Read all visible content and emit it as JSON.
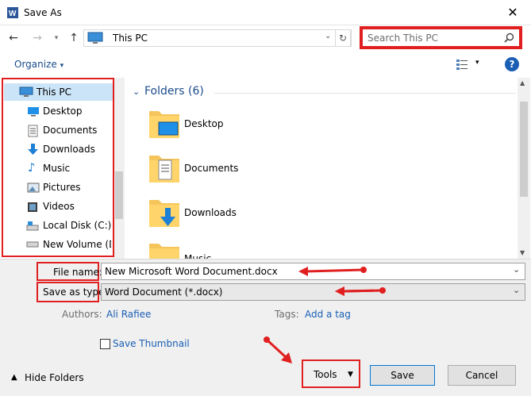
{
  "window": {
    "title": "Save As"
  },
  "address": {
    "location": "This PC"
  },
  "search": {
    "placeholder": "Search This PC"
  },
  "toolbar": {
    "organize": "Organize"
  },
  "sidebar": {
    "items": [
      {
        "label": "This PC"
      },
      {
        "label": "Desktop"
      },
      {
        "label": "Documents"
      },
      {
        "label": "Downloads"
      },
      {
        "label": "Music"
      },
      {
        "label": "Pictures"
      },
      {
        "label": "Videos"
      },
      {
        "label": "Local Disk (C:)"
      },
      {
        "label": "New Volume (D:"
      }
    ]
  },
  "main": {
    "section_title": "Folders (6)",
    "folders": [
      {
        "label": "Desktop"
      },
      {
        "label": "Documents"
      },
      {
        "label": "Downloads"
      },
      {
        "label": "Music"
      }
    ]
  },
  "form": {
    "file_name_label": "File name:",
    "file_name_value": "New Microsoft Word Document.docx",
    "save_type_label": "Save as type:",
    "save_type_value": "Word Document (*.docx)",
    "authors_label": "Authors:",
    "authors_value": "Ali Rafiee",
    "tags_label": "Tags:",
    "tags_value": "Add a tag",
    "thumbnail_label": "Save Thumbnail"
  },
  "footer": {
    "hide_folders": "Hide Folders",
    "tools": "Tools",
    "save": "Save",
    "cancel": "Cancel"
  },
  "colors": {
    "annotation": "#e02020",
    "accent": "#0078d7",
    "link": "#1a5fb4"
  }
}
